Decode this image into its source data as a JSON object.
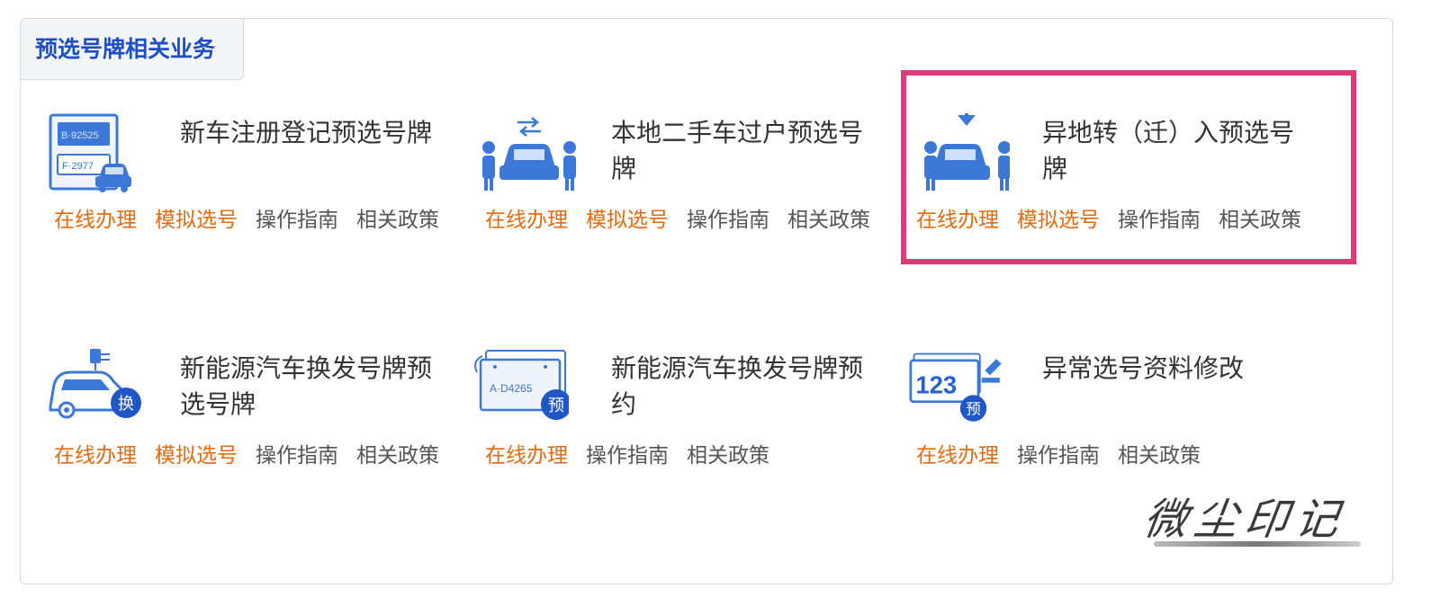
{
  "section": {
    "title": "预选号牌相关业务"
  },
  "services": [
    {
      "title": "新车注册登记预选号牌",
      "icon": "license-plate-car-icon",
      "plate_texts": [
        "B·92525",
        "F·2977"
      ],
      "links": [
        {
          "label": "在线办理",
          "style": "orange"
        },
        {
          "label": "模拟选号",
          "style": "orange"
        },
        {
          "label": "操作指南",
          "style": "gray"
        },
        {
          "label": "相关政策",
          "style": "gray"
        }
      ]
    },
    {
      "title": "本地二手车过户预选号牌",
      "icon": "car-transfer-icon",
      "links": [
        {
          "label": "在线办理",
          "style": "orange"
        },
        {
          "label": "模拟选号",
          "style": "orange"
        },
        {
          "label": "操作指南",
          "style": "gray"
        },
        {
          "label": "相关政策",
          "style": "gray"
        }
      ]
    },
    {
      "title": "异地转（迁）入预选号牌",
      "icon": "car-transfer-in-icon",
      "links": [
        {
          "label": "在线办理",
          "style": "orange"
        },
        {
          "label": "模拟选号",
          "style": "orange"
        },
        {
          "label": "操作指南",
          "style": "gray"
        },
        {
          "label": "相关政策",
          "style": "gray"
        }
      ]
    },
    {
      "title": "新能源汽车换发号牌预选号牌",
      "icon": "electric-car-icon",
      "badge": "换",
      "links": [
        {
          "label": "在线办理",
          "style": "orange"
        },
        {
          "label": "模拟选号",
          "style": "orange"
        },
        {
          "label": "操作指南",
          "style": "gray"
        },
        {
          "label": "相关政策",
          "style": "gray"
        }
      ]
    },
    {
      "title": "新能源汽车换发号牌预约",
      "icon": "plate-reservation-icon",
      "badge": "预",
      "plate_text": "A·D4265",
      "links": [
        {
          "label": "在线办理",
          "style": "orange"
        },
        {
          "label": "操作指南",
          "style": "gray"
        },
        {
          "label": "相关政策",
          "style": "gray"
        }
      ]
    },
    {
      "title": "异常选号资料修改",
      "icon": "number-edit-icon",
      "badge": "预",
      "number_text": "123",
      "links": [
        {
          "label": "在线办理",
          "style": "orange"
        },
        {
          "label": "操作指南",
          "style": "gray"
        },
        {
          "label": "相关政策",
          "style": "gray"
        }
      ]
    }
  ],
  "watermark": "微尘印记",
  "colors": {
    "accent_blue": "#1d4fc4",
    "link_orange": "#e86a0d",
    "highlight": "#e0397a",
    "icon_blue": "#3c78d8"
  }
}
